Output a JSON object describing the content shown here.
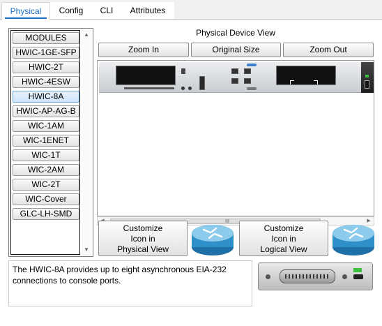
{
  "tabs": [
    {
      "label": "Physical",
      "active": true
    },
    {
      "label": "Config",
      "active": false
    },
    {
      "label": "CLI",
      "active": false
    },
    {
      "label": "Attributes",
      "active": false
    }
  ],
  "modules": {
    "items": [
      "MODULES",
      "HWIC-1GE-SFP",
      "HWIC-2T",
      "HWIC-4ESW",
      "HWIC-8A",
      "HWIC-AP-AG-B",
      "WIC-1AM",
      "WIC-1ENET",
      "WIC-1T",
      "WIC-2AM",
      "WIC-2T",
      "WIC-Cover",
      "GLC-LH-SMD"
    ],
    "selected": "HWIC-8A"
  },
  "physical_view": {
    "title": "Physical Device View",
    "zoom_in": "Zoom In",
    "original_size": "Original Size",
    "zoom_out": "Zoom Out",
    "scroll_grip": "III"
  },
  "customize": {
    "physical": {
      "line1": "Customize",
      "line2": "Icon in",
      "line3": "Physical View"
    },
    "logical": {
      "line1": "Customize",
      "line2": "Icon in",
      "line3": "Logical View"
    }
  },
  "description": "The HWIC-8A provides up to eight asynchronous EIA-232 connections to console ports.",
  "colors": {
    "accent": "#1a6fc4",
    "router_blue": "#2f8fc8"
  }
}
